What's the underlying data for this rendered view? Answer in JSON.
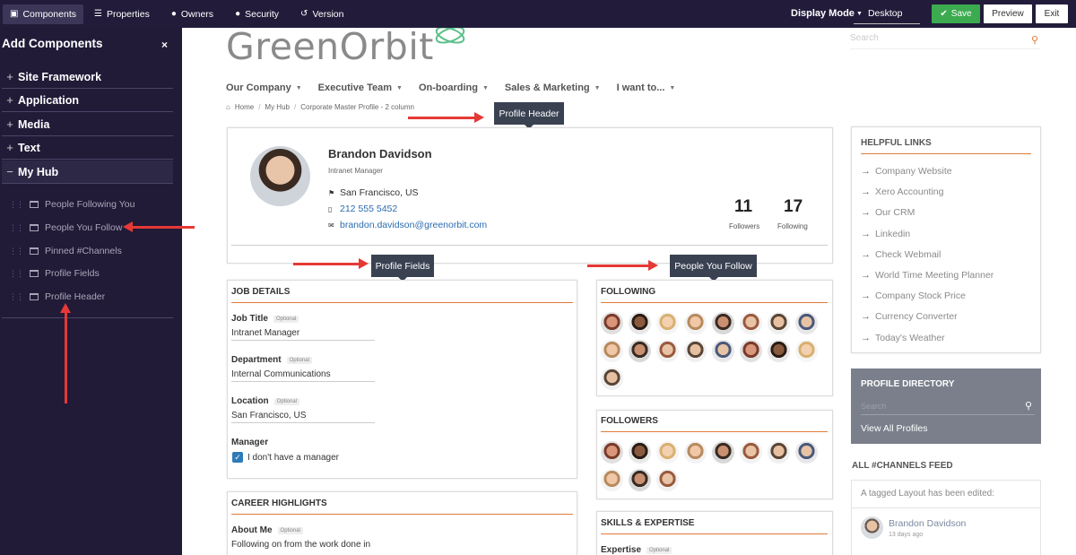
{
  "topbar": {
    "tabs": [
      {
        "label": "Components",
        "icon": "components-icon"
      },
      {
        "label": "Properties",
        "icon": "list-icon"
      },
      {
        "label": "Owners",
        "icon": "user-icon"
      },
      {
        "label": "Security",
        "icon": "user-shield-icon"
      },
      {
        "label": "Version",
        "icon": "history-icon"
      }
    ],
    "display_mode_label": "Display Mode",
    "display_mode_value": "Desktop",
    "save_label": "Save",
    "preview_label": "Preview",
    "exit_label": "Exit"
  },
  "sidebar": {
    "title": "Add Components",
    "close": "×",
    "categories": [
      {
        "label": "Site Framework",
        "sign": "+"
      },
      {
        "label": "Application",
        "sign": "+"
      },
      {
        "label": "Media",
        "sign": "+"
      },
      {
        "label": "Text",
        "sign": "+"
      },
      {
        "label": "My Hub",
        "sign": "−"
      }
    ],
    "components": [
      "People Following You",
      "People You Follow",
      "Pinned #Channels",
      "Profile Fields",
      "Profile Header"
    ]
  },
  "site": {
    "logo": "GreenOrbit",
    "search_placeholder": "Search",
    "nav": [
      "Our Company",
      "Executive Team",
      "On-boarding",
      "Sales & Marketing",
      "I want to..."
    ],
    "breadcrumb": [
      "Home",
      "My Hub",
      "Corporate Master Profile - 2 column"
    ]
  },
  "tooltips": {
    "profile_header": "Profile Header",
    "profile_fields": "Profile Fields",
    "people_you_follow": "People You Follow"
  },
  "profile": {
    "name": "Brandon Davidson",
    "title": "Intranet Manager",
    "location": "San Francisco, US",
    "phone": "212 555 5452",
    "email": "brandon.davidson@greenorbit.com",
    "followers_count": "11",
    "followers_label": "Followers",
    "following_count": "17",
    "following_label": "Following"
  },
  "job_details": {
    "title": "JOB DETAILS",
    "optional": "Optional",
    "fields": [
      {
        "label": "Job Title",
        "value": "Intranet Manager"
      },
      {
        "label": "Department",
        "value": "Internal Communications"
      },
      {
        "label": "Location",
        "value": "San Francisco, US"
      }
    ],
    "manager_label": "Manager",
    "manager_checkbox": "I don't have a manager"
  },
  "career": {
    "title": "CAREER HIGHLIGHTS",
    "about_label": "About Me",
    "about_value": "Following on from the work done in"
  },
  "following_title": "FOLLOWING",
  "followers_title": "FOLLOWERS",
  "skills": {
    "title": "SKILLS & EXPERTISE",
    "expertise_label": "Expertise"
  },
  "helpful_links": {
    "title": "HELPFUL LINKS",
    "items": [
      "Company Website",
      "Xero Accounting",
      "Our CRM",
      "Linkedin",
      "Check Webmail",
      "World Time Meeting Planner",
      "Company Stock Price",
      "Currency Converter",
      "Today's Weather"
    ]
  },
  "directory": {
    "title": "PROFILE DIRECTORY",
    "search_placeholder": "Search",
    "view_all": "View All Profiles"
  },
  "feed": {
    "title": "ALL #CHANNELS FEED",
    "text": "A tagged Layout has been edited:",
    "author": "Brandon Davidson",
    "time": "13 days ago"
  },
  "colors": {
    "topbar": "#221c3a",
    "sidebar": "#211b38",
    "save": "#3cab4f",
    "accent": "#e07b39",
    "arrow": "#e53935",
    "tooltip": "#3a4252"
  }
}
